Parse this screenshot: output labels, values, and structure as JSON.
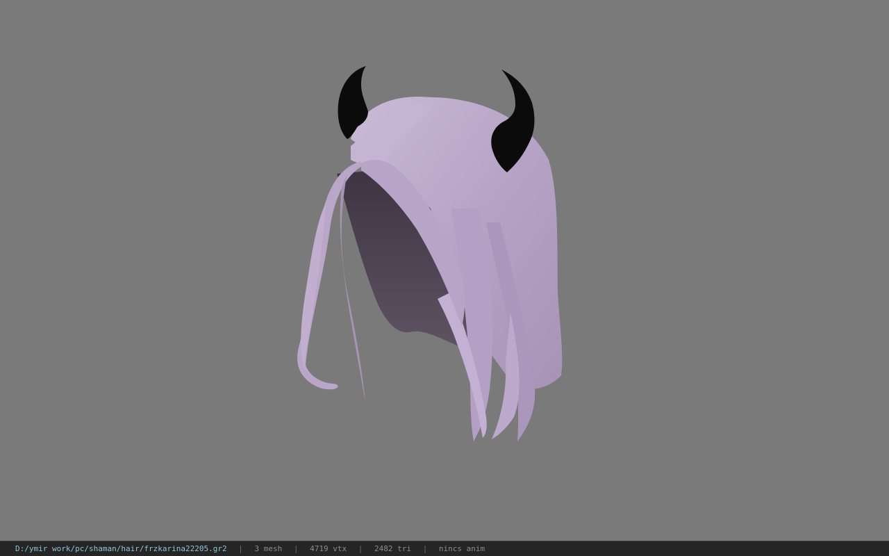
{
  "viewport": {
    "background_color": "#7a7a7a",
    "model": {
      "hair_color": "#b9a6c8",
      "horn_color": "#0b0b0b"
    }
  },
  "status": {
    "file_path": "D:/ymir work/pc/shaman/hair/frzkarina22205.gr2",
    "separator": "|",
    "mesh": "3 mesh",
    "vtx": "4719 vtx",
    "tri": "2482 tri",
    "anim": "nincs anim"
  }
}
